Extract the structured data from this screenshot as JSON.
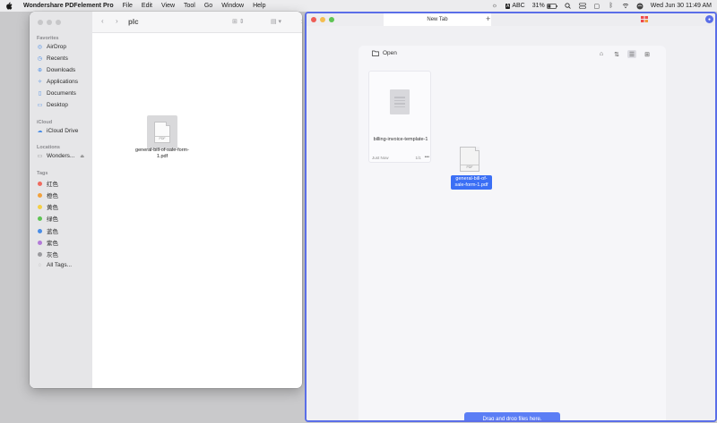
{
  "menubar": {
    "app_name": "Wondershare PDFelement Pro",
    "items": [
      "File",
      "Edit",
      "View",
      "Tool",
      "Go",
      "Window",
      "Help"
    ],
    "input_source": "ABC",
    "battery": "31%",
    "datetime": "Wed Jun 30  11:49 AM"
  },
  "finder": {
    "title": "plc",
    "sidebar": {
      "favorites_header": "Favorites",
      "favorites": [
        "AirDrop",
        "Recents",
        "Downloads",
        "Applications",
        "Documents",
        "Desktop"
      ],
      "icloud_header": "iCloud",
      "icloud": [
        "iCloud Drive"
      ],
      "locations_header": "Locations",
      "locations": [
        "Wonders..."
      ],
      "tags_header": "Tags",
      "tags": [
        {
          "label": "红色",
          "color": "#ef6b5f"
        },
        {
          "label": "橙色",
          "color": "#f2a23c"
        },
        {
          "label": "黄色",
          "color": "#f4cf45"
        },
        {
          "label": "绿色",
          "color": "#5ec454"
        },
        {
          "label": "蓝色",
          "color": "#4a8de6"
        },
        {
          "label": "紫色",
          "color": "#b37ad8"
        },
        {
          "label": "灰色",
          "color": "#9a9a9e"
        }
      ],
      "all_tags": "All Tags..."
    },
    "file": {
      "name": "general-bill-of-sale-form-1.pdf",
      "badge": "PDF"
    }
  },
  "pdfelement": {
    "tab_title": "New Tab",
    "open_label": "Open",
    "recent_doc": {
      "name": "billing-invoice-template-1",
      "time": "Just Now",
      "pages": "1/1"
    },
    "dragged_file": {
      "name": "general-bill-of-sale-form-1.pdf",
      "badge": "PDF"
    },
    "drop_hint": "Drag and drop files here.",
    "accent": "#5b7ef5"
  }
}
